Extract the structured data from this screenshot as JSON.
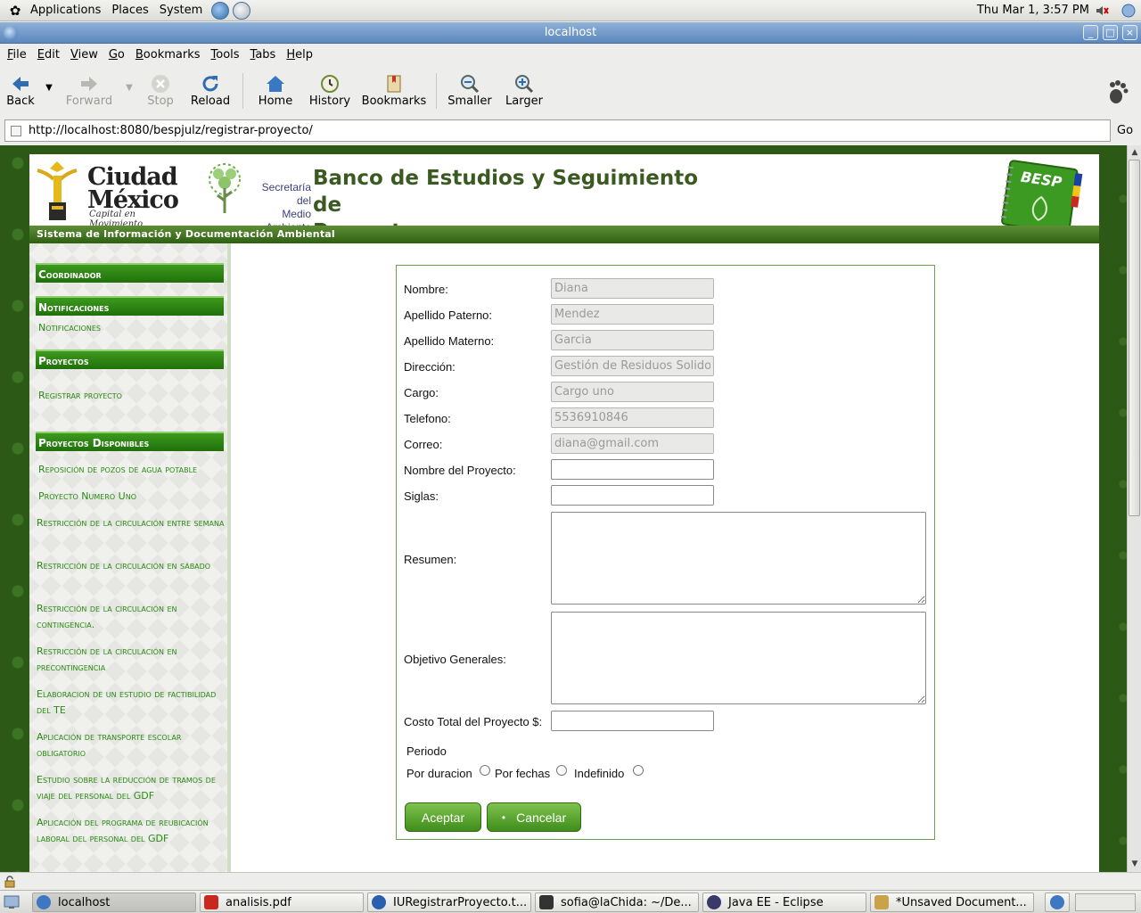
{
  "panel": {
    "menus": [
      "Applications",
      "Places",
      "System"
    ],
    "clock": "Thu Mar  1,  3:57 PM"
  },
  "window": {
    "title": "localhost",
    "minimize": "_",
    "maximize": "□",
    "close": "×"
  },
  "menubar": [
    {
      "u": "F",
      "rest": "ile"
    },
    {
      "u": "E",
      "rest": "dit"
    },
    {
      "u": "V",
      "rest": "iew"
    },
    {
      "u": "G",
      "rest": "o"
    },
    {
      "u": "B",
      "rest": "ookmarks"
    },
    {
      "u": "T",
      "rest": "ools"
    },
    {
      "u": "T",
      "rest": "abs"
    },
    {
      "u": "H",
      "rest": "elp"
    }
  ],
  "toolbar": {
    "back": "Back",
    "forward": "Forward",
    "stop": "Stop",
    "reload": "Reload",
    "home": "Home",
    "history": "History",
    "bookmarks": "Bookmarks",
    "smaller": "Smaller",
    "larger": "Larger"
  },
  "location": {
    "url": "http://localhost:8080/bespjulz/registrar-proyecto/",
    "go": "Go"
  },
  "site": {
    "logo_line1": "Ciudad",
    "logo_line2": "México",
    "logo_tagline": "Capital en Movimiento",
    "sma_line1": "Secretaría del",
    "sma_line2": "Medio Ambiente",
    "title_line1": "Banco de Estudios y Seguimiento de",
    "title_line2": "Proyectos",
    "besp_logo": "BESP",
    "subtitle": "Sistema de Información y Documentación Ambiental"
  },
  "sidebar": {
    "coordinador": "Coordinador",
    "notificaciones_head": "Notificaciones",
    "notificaciones_link": "Notificaciones",
    "proyectos_head": "Proyectos",
    "registrar_link": "Registrar proyecto",
    "disponibles_head": "Proyectos Disponibles",
    "disponibles": [
      "Reposición de pozos de agua potable",
      "Proyecto Numero Uno",
      "Restricción de la circulación entre semana",
      "Restricción de la circulación en sábado",
      "Restricción de la circulación en contingencia.",
      "Restricción de la circulación en precontingencia",
      "Elaboracion de un estudio de factibilidad del TE",
      "Aplicación de transporte escolar obligatorio",
      "Estudio sobre la reducción de tramos de viaje del personal del GDF",
      "Aplicación del programa de reubicación laboral del personal del GDF"
    ]
  },
  "form": {
    "labels": {
      "nombre": "Nombre:",
      "apellido_paterno": "Apellido Paterno:",
      "apellido_materno": "Apellido Materno:",
      "direccion": "Dirección:",
      "cargo": "Cargo:",
      "telefono": "Telefono:",
      "correo": "Correo:",
      "nombre_proyecto": "Nombre del Proyecto:",
      "siglas": "Siglas:",
      "resumen": "Resumen:",
      "objetivo": "Objetivo Generales:",
      "costo": "Costo Total del Proyecto $:",
      "periodo": "Periodo",
      "por_duracion": "Por duracion",
      "por_fechas": "Por fechas",
      "indefinido": "Indefinido"
    },
    "values": {
      "nombre": "Diana",
      "apellido_paterno": "Mendez",
      "apellido_materno": "Garcia",
      "direccion": "Gestión de Residuos Solidos",
      "cargo": "Cargo uno",
      "telefono": "5536910846",
      "correo": "diana@gmail.com",
      "nombre_proyecto": "",
      "siglas": "",
      "costo": ""
    },
    "aceptar": "Aceptar",
    "cancelar": "Cancelar",
    "cancelar_bullet": "•"
  },
  "taskbar": [
    {
      "label": "localhost",
      "color": "#3f78c2",
      "active": true
    },
    {
      "label": "analisis.pdf",
      "color": "#c8281e",
      "active": false
    },
    {
      "label": "IURegistrarProyecto.t...",
      "color": "#2a5fb0",
      "active": false
    },
    {
      "label": "sofia@laChida: ~/De...",
      "color": "#333333",
      "active": false
    },
    {
      "label": "Java EE - Eclipse",
      "color": "#3a3a6a",
      "active": false
    },
    {
      "label": "*Unsaved Document...",
      "color": "#c9a24a",
      "active": false
    }
  ],
  "colors": {
    "accent_green": "#3f8d1b",
    "title_green": "#3b5a22",
    "link_green": "#2a8a14"
  }
}
